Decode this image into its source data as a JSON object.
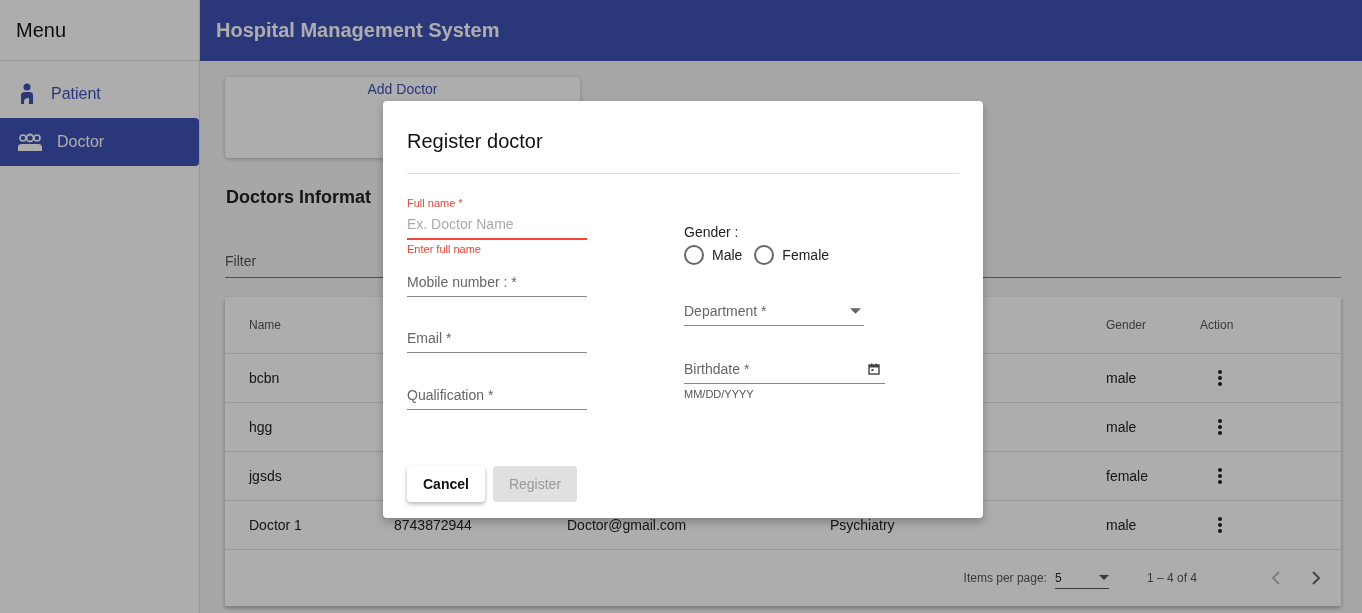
{
  "sidebar": {
    "title": "Menu",
    "items": [
      {
        "label": "Patient",
        "selected": false
      },
      {
        "label": "Doctor",
        "selected": true
      }
    ]
  },
  "header": {
    "title": "Hospital Management System"
  },
  "add_card": {
    "label": "Add Doctor"
  },
  "section_title": "Doctors Informat",
  "filter": {
    "label": "Filter"
  },
  "table": {
    "columns": [
      {
        "label": "Name"
      },
      {
        "label": "Gender"
      },
      {
        "label": "Action"
      }
    ],
    "rows": [
      {
        "name": "bcbn",
        "gender": "male"
      },
      {
        "name": "hgg",
        "gender": "male"
      },
      {
        "name": "jgsds",
        "gender": "female"
      },
      {
        "name": "Doctor 1",
        "mobile": "8743872944",
        "email": "Doctor@gmail.com",
        "department": "Psychiatry",
        "gender": "male"
      }
    ],
    "paginator": {
      "label": "Items per page:",
      "page_size": "5",
      "range": "1 – 4 of 4",
      "prev_disabled": true,
      "next_disabled": false
    }
  },
  "dialog": {
    "title": "Register doctor",
    "left_fields": [
      {
        "kind": "text",
        "label": "Full name *",
        "placeholder": "Ex. Doctor Name",
        "error": "Enter full name",
        "invalid": true
      },
      {
        "kind": "text",
        "label": "Mobile number : *",
        "invalid": false
      },
      {
        "kind": "text",
        "label": "Email *",
        "invalid": false
      },
      {
        "kind": "text",
        "label": "Qualification *",
        "invalid": false
      }
    ],
    "right_fields": [
      {
        "kind": "radio",
        "label": "Gender :",
        "options": [
          {
            "label": "Male",
            "selected": false
          },
          {
            "label": "Female",
            "selected": false
          }
        ]
      },
      {
        "kind": "select",
        "label": "Department *"
      },
      {
        "kind": "date",
        "label": "Birthdate *",
        "hint": "MM/DD/YYYY"
      }
    ],
    "buttons": [
      {
        "label": "Cancel",
        "disabled": false
      },
      {
        "label": "Register",
        "disabled": true
      }
    ]
  }
}
